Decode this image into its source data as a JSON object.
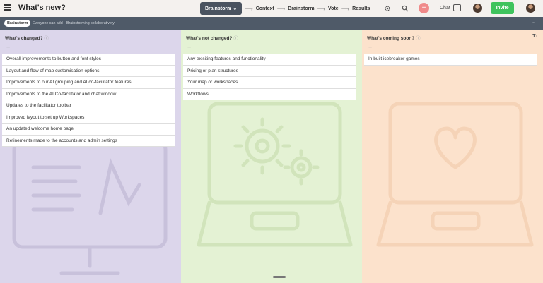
{
  "header": {
    "title": "What's new?",
    "steps": {
      "active": "Brainstorm",
      "items": [
        "Context",
        "Brainstorm",
        "Vote",
        "Results"
      ]
    },
    "chat_label": "Chat",
    "invite_label": "Invite"
  },
  "subbar": {
    "phase": "Brainstorm",
    "note_1": "Everyone can add",
    "note_2": "Brainstorming collaboratively"
  },
  "columns": [
    {
      "title": "What's changed?",
      "cards": [
        "Overall improvements to button and font styles",
        "Layout and flow of map customisation options",
        "Improvements to our AI grouping and AI co-facilitator features",
        "Improvements to the AI Co-facilitator and chat window",
        "Updates to the facilitator toolbar",
        "Improved layout to set up Workspaces",
        "An updated welcome home page",
        "Refinements made to the accounts and admin settings"
      ]
    },
    {
      "title": "What's not changed?",
      "cards": [
        "Any exisiting features and functionality",
        "Pricing or plan structures",
        "Your map or workspaces",
        "Workflows"
      ]
    },
    {
      "title": "What's coming soon?",
      "cards": [
        "In built icebreaker games"
      ]
    }
  ],
  "icons": {
    "menu": "hamburger-icon",
    "settings": "gear-icon",
    "search": "search-icon",
    "add": "plus-circle-icon",
    "chat": "chat-icon",
    "text_tool": "text-size-icon"
  },
  "colors": {
    "column_1": "#dcd6eb",
    "column_2": "#e4f2d4",
    "column_3": "#fce2cc",
    "invite": "#3fc35d",
    "subbar": "#4f5a68",
    "active_step": "#4a5360"
  }
}
